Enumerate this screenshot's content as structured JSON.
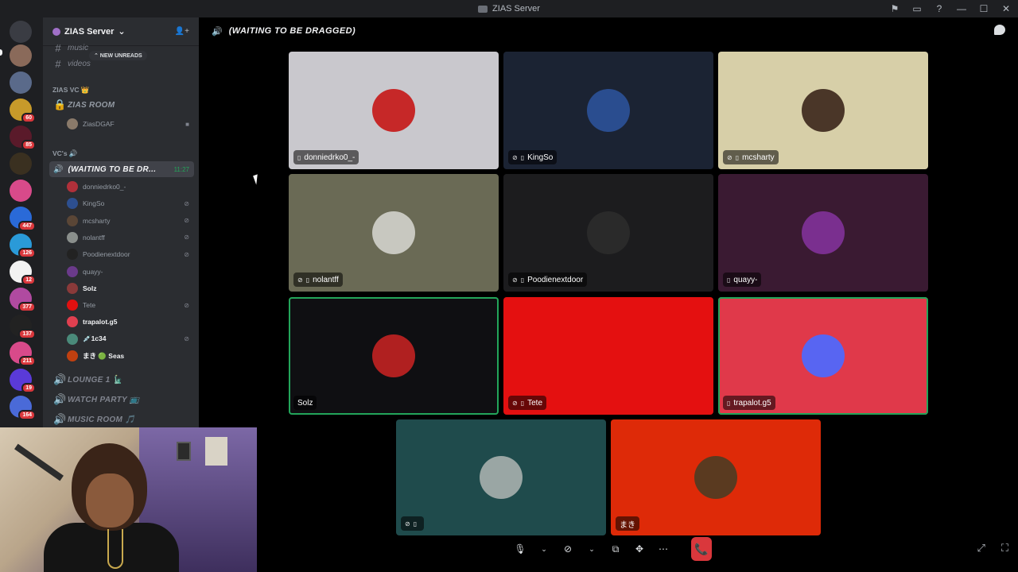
{
  "window": {
    "title": "ZIAS Server"
  },
  "server": {
    "name": "ZIAS Server",
    "new_unreads": "⌃ NEW UNREADS"
  },
  "channels_top": [
    {
      "label": "music"
    },
    {
      "label": "videos"
    }
  ],
  "category_zias_vc": {
    "label": "ZIAS VC 👑"
  },
  "zias_room": {
    "label": "ZIAS ROOM",
    "member": "ZiasDGAF"
  },
  "category_vcs": {
    "label": "VC's 🔊"
  },
  "active_vc": {
    "label": "(WAITING TO BE DR...",
    "timer": "11:27"
  },
  "members": [
    {
      "name": "donniedrko0_-",
      "bright": false,
      "color": "#b0303a"
    },
    {
      "name": "KingSo",
      "bright": false,
      "color": "#2d4f8f"
    },
    {
      "name": "mcsharty",
      "bright": false,
      "color": "#5a4636"
    },
    {
      "name": "nolantff",
      "bright": false,
      "color": "#8a8f8c"
    },
    {
      "name": "Poodienextdoor",
      "bright": false,
      "color": "#222"
    },
    {
      "name": "quayy-",
      "bright": false,
      "color": "#6a3a8a"
    },
    {
      "name": "Solz",
      "bright": true,
      "color": "#8a3a3a"
    },
    {
      "name": "Tete",
      "bright": false,
      "color": "#e01010"
    },
    {
      "name": "trapalot.g5",
      "bright": true,
      "color": "#e04050"
    },
    {
      "name": "💉1c34",
      "bright": true,
      "color": "#4a8a7a"
    },
    {
      "name": "まき 🟢 Seas",
      "bright": true,
      "color": "#c04010"
    }
  ],
  "voice_channels": [
    {
      "label": "LOUNGE 1 🗽"
    },
    {
      "label": "WATCH PARTY 📺"
    },
    {
      "label": "MUSIC ROOM 🎵"
    }
  ],
  "stage": {
    "title": "(WAITING TO BE DRAGGED)"
  },
  "tiles": [
    {
      "name": "donniedrko0_-",
      "bg": "#c9c8cd",
      "avatar": "#c62828"
    },
    {
      "name": "KingSo",
      "bg": "#1b2333",
      "avatar": "#2a4d8f"
    },
    {
      "name": "mcsharty",
      "bg": "#d7cfa8",
      "avatar": "#4a3628"
    },
    {
      "name": "nolantff",
      "bg": "#6a6a55",
      "avatar": "#c8c8c0"
    },
    {
      "name": "Poodienextdoor",
      "bg": "#1c1c1e",
      "avatar": "#2a2a2a"
    },
    {
      "name": "quayy-",
      "bg": "#3a1a32",
      "avatar": "#7a2f8f"
    },
    {
      "name": "Solz",
      "bg": "#0f0f12",
      "avatar": "#b02020"
    },
    {
      "name": "Tete",
      "bg": "#e41010",
      "avatar": "#e41010"
    },
    {
      "name": "trapalot.g5",
      "bg": "#e0394a",
      "avatar": "#5865f2"
    },
    {
      "name": "",
      "bg": "#1f4b4c",
      "avatar": "#9aa6a4"
    },
    {
      "name": "まき",
      "bg": "#de2a08",
      "avatar": "#5a3a20"
    }
  ],
  "controls": {
    "mic": "🎙",
    "camera": "⊘",
    "share": "⧉",
    "activity": "✥",
    "more": "⋯",
    "end": "📞"
  },
  "icons": {
    "notifications": "⚑",
    "inbox": "▭",
    "help": "?",
    "invite": "👤+",
    "chat": "speech-bubble",
    "popout": "⤢",
    "fullscreen": "⛶"
  }
}
